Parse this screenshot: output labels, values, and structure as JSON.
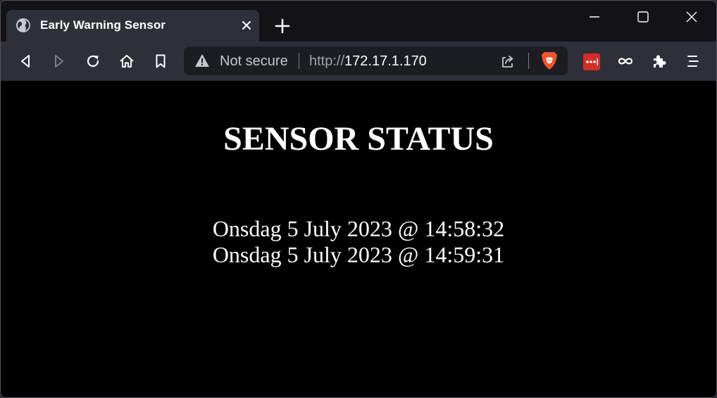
{
  "browser": {
    "tab": {
      "title": "Early Warning Sensor"
    },
    "address_bar": {
      "security_label": "Not secure",
      "url_scheme": "http://",
      "url_host": "172.17.1.170"
    },
    "icons": {
      "favicon": "globe-icon",
      "tab_close": "close-icon",
      "new_tab": "plus-icon",
      "minimize": "minimize-icon",
      "maximize": "maximize-icon",
      "close_window": "close-icon",
      "back": "back-icon",
      "forward": "forward-icon",
      "reload": "reload-icon",
      "home": "home-icon",
      "bookmark": "bookmark-icon",
      "warning": "warning-icon",
      "share": "share-icon",
      "shields": "brave-lion-icon",
      "extension_1": "lastpass-icon",
      "extension_2": "infinity-icon",
      "extensions": "puzzle-icon",
      "menu": "hamburger-menu-icon"
    },
    "colors": {
      "tabstrip": "#121217",
      "toolbar": "#2e3039",
      "urlbar": "#1c1d22",
      "brave_orange": "#f2542d",
      "extension_red": "#d32d27"
    }
  },
  "page": {
    "heading": "SENSOR STATUS",
    "status_lines": [
      "Onsdag 5 July 2023 @ 14:58:32",
      "Onsdag 5 July 2023 @ 14:59:31"
    ],
    "background": "#000000",
    "text_color": "#ffffff"
  }
}
